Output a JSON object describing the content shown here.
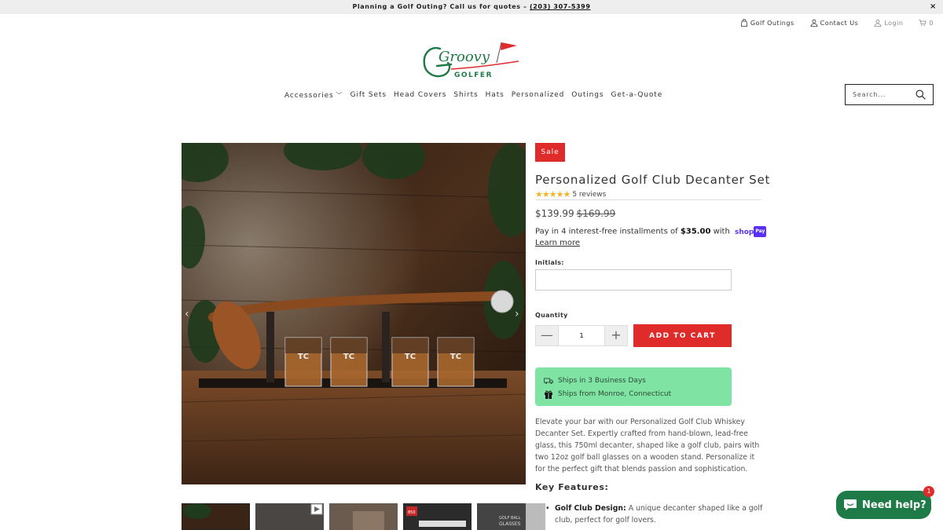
{
  "announcement": {
    "text": "Planning a Golf Outing? Call us for quotes – ",
    "phone": "(203) 307-5399",
    "close_symbol": "×"
  },
  "utility": {
    "golf_outings": "Golf Outings",
    "contact": "Contact Us",
    "login": "Login",
    "cart_count": "0"
  },
  "logo": {
    "word": "Groovy",
    "sub": "GOLFER"
  },
  "nav": {
    "items": [
      "Accessories",
      "Gift Sets",
      "Head Covers",
      "Shirts",
      "Hats",
      "Personalized",
      "Outings",
      "Get-a-Quote"
    ]
  },
  "search": {
    "placeholder": "Search..."
  },
  "product": {
    "sale_badge": "Sale",
    "title": "Personalized Golf Club Decanter Set",
    "stars": "★★★★★",
    "reviews": "5 reviews",
    "rating": 4.5,
    "price": "$139.99",
    "compare_price": "$169.99",
    "installments_pre": "Pay in 4 interest-free installments of ",
    "installment_amount": "$35.00",
    "installments_with": " with ",
    "shop_pay_word": "shop",
    "shop_pay_badge": "Pay",
    "learn_more": "Learn more",
    "initials_label": "Initials:",
    "quantity_label": "Quantity",
    "quantity_value": "1",
    "minus": "—",
    "plus": "+",
    "add_to_cart": "ADD TO CART",
    "ships_days": "Ships in 3 Business Days",
    "ships_from": "Ships from Monroe, Connecticut",
    "description": "Elevate your bar with our Personalized Golf Club Whiskey Decanter Set. Expertly crafted from hand-blown, lead-free glass, this 750ml decanter, shaped like a golf club, pairs with two 12oz golf ball glasses on a wooden stand. Personalize it for the perfect gift that blends passion and sophistication.",
    "key_features": "Key Features:",
    "feature_1_title": "Golf Club Design:",
    "feature_1_text": " A unique decanter shaped like a golf club, perfect for golf lovers.",
    "glass_engraving": "TC"
  },
  "thumbs": {
    "badge_850": "850",
    "golf_ball": "GOLF BALL",
    "glasses": "GLASSES"
  },
  "chat": {
    "label": "Need help?",
    "badge": "1"
  },
  "colors": {
    "accent_red": "#e02b2b",
    "ship_green": "#7fe3a3",
    "chat_green": "#1e7a46"
  }
}
